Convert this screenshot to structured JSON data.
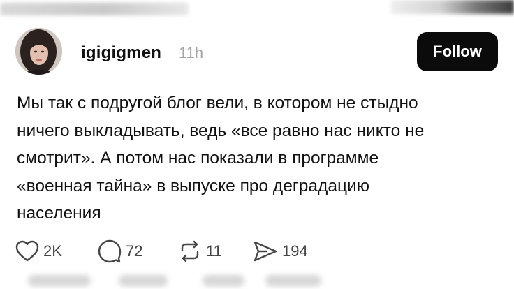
{
  "post": {
    "author": {
      "username": "igigigmen",
      "avatar_icon": "profile-photo"
    },
    "timestamp": "11h",
    "follow_label": "Follow",
    "body_lines": [
      "Мы так с подругой блог вели, в котором не стыдно",
      "ничего выкладывать, ведь «все равно нас никто не",
      "смотрит». А потом нас показали в программе",
      "«военная тайна» в выпуске про деградацию",
      "населения"
    ],
    "actions": {
      "likes": {
        "icon": "heart-icon",
        "count": "2K"
      },
      "replies": {
        "icon": "comment-icon",
        "count": "72"
      },
      "reposts": {
        "icon": "repost-icon",
        "count": "11"
      },
      "shares": {
        "icon": "send-icon",
        "count": "194"
      }
    }
  },
  "colors": {
    "follow_bg": "#0b0b0b",
    "text": "#111111",
    "muted": "#a3a3a3",
    "icon": "#454545"
  }
}
